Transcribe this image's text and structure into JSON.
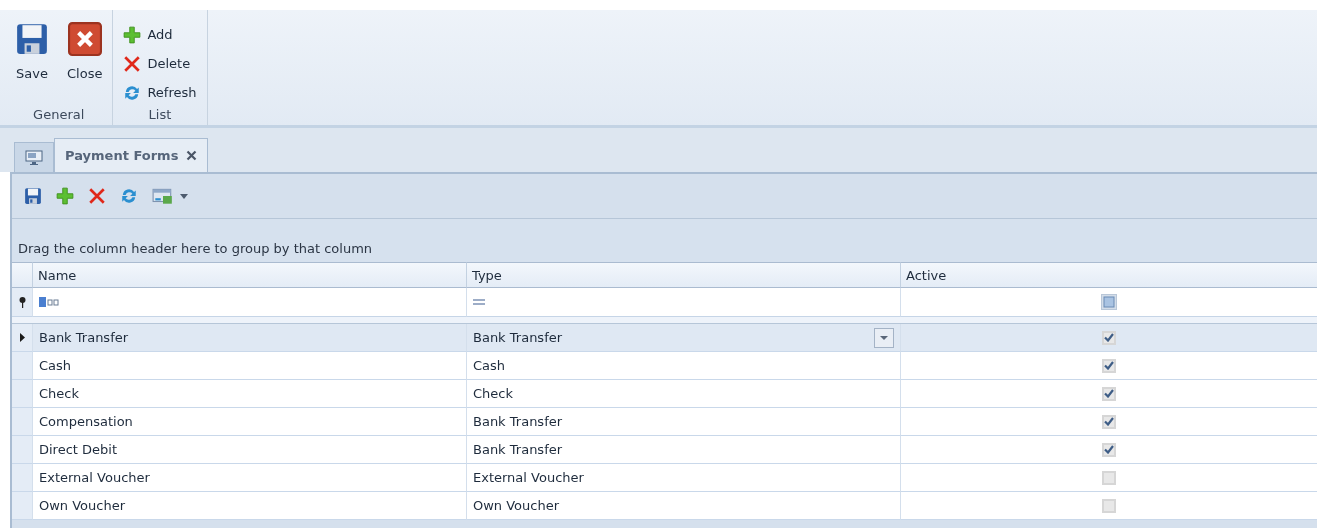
{
  "ribbon": {
    "groups": [
      {
        "label": "General",
        "buttons": [
          {
            "label": "Save"
          },
          {
            "label": "Close"
          }
        ]
      },
      {
        "label": "List",
        "buttons": [
          {
            "label": "Add"
          },
          {
            "label": "Delete"
          },
          {
            "label": "Refresh"
          }
        ]
      }
    ]
  },
  "tabs": [
    {
      "label": "Payment Forms",
      "selected": true
    }
  ],
  "group_panel": {
    "hint": "Drag the column header here to group by that column"
  },
  "table": {
    "columns": [
      "Name",
      "Type",
      "Active"
    ],
    "rows": [
      {
        "name": "Bank Transfer",
        "type": "Bank Transfer",
        "active": true,
        "selected": true
      },
      {
        "name": "Cash",
        "type": "Cash",
        "active": true,
        "selected": false
      },
      {
        "name": "Check",
        "type": "Check",
        "active": true,
        "selected": false
      },
      {
        "name": "Compensation",
        "type": "Bank Transfer",
        "active": true,
        "selected": false
      },
      {
        "name": "Direct Debit",
        "type": "Bank Transfer",
        "active": true,
        "selected": false
      },
      {
        "name": "External Voucher",
        "type": "External Voucher",
        "active": false,
        "selected": false
      },
      {
        "name": "Own Voucher",
        "type": "Own Voucher",
        "active": false,
        "selected": false
      }
    ]
  }
}
